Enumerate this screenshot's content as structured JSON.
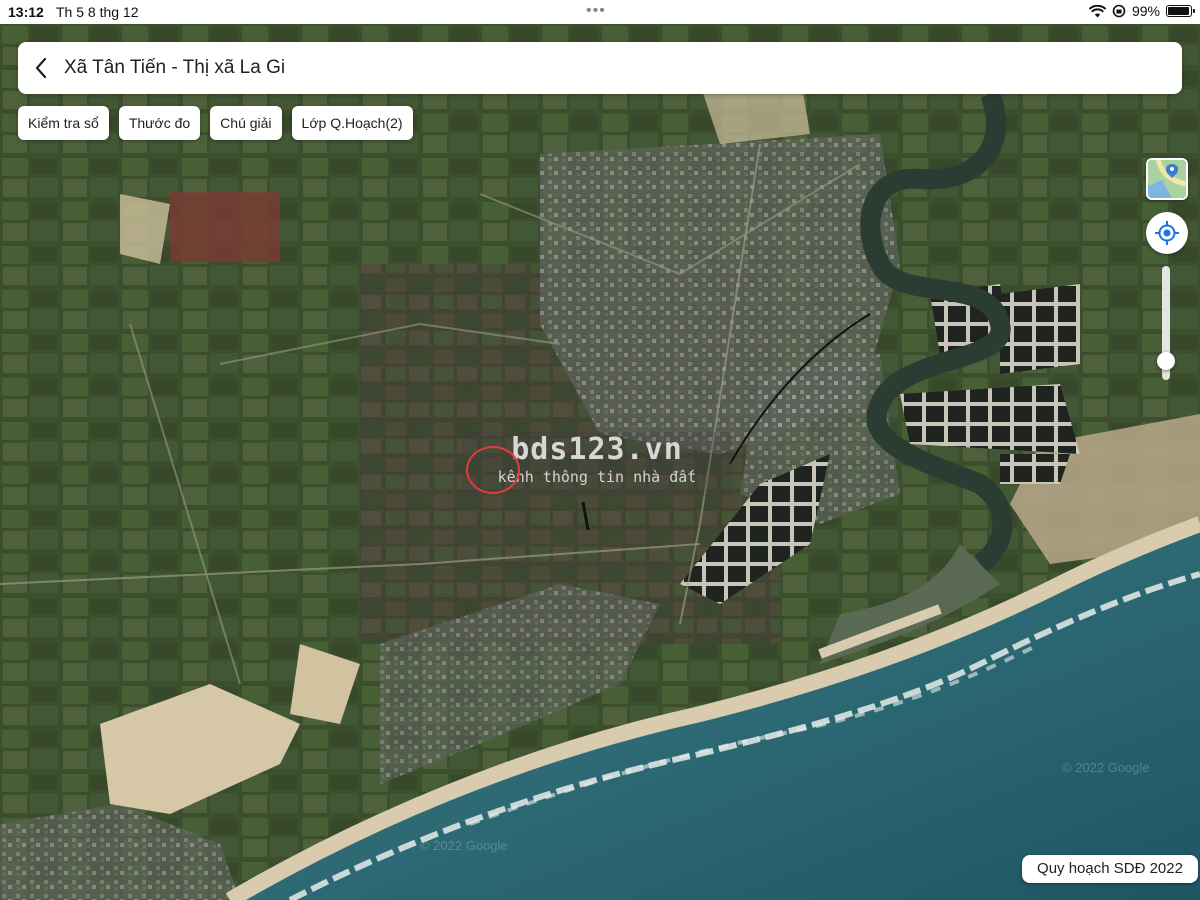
{
  "status_bar": {
    "time": "13:12",
    "date": "Th 5 8 thg 12",
    "battery": "99%",
    "battery_level": 0.99
  },
  "header": {
    "title": "Xã Tân Tiến - Thị xã La Gi",
    "back_icon": "chevron-left-icon"
  },
  "toolbar": {
    "chips": [
      "Kiểm tra sổ",
      "Thước đo",
      "Chú giải",
      "Lớp Q.Hoạch(2)"
    ]
  },
  "map": {
    "type": "satellite",
    "colors": {
      "land_dark": "#39472f",
      "land_green": "#4d6b3a",
      "sand": "#d6c8a6",
      "sea": "#2e6a76",
      "sea_deep": "#235866",
      "surf": "#e6ece9",
      "river": "#2b3d33"
    },
    "watermark": {
      "brand": "bds123.vn",
      "tagline": "kênh thông tin nhà đất"
    },
    "attribution": [
      "© 2022 Google",
      "© 2022 Google"
    ],
    "zoom_level": 0.9
  },
  "controls": {
    "layer_icon": "map-layer-icon",
    "locate_icon": "my-location-icon"
  },
  "plan_label": "Quy hoạch SDĐ 2022"
}
